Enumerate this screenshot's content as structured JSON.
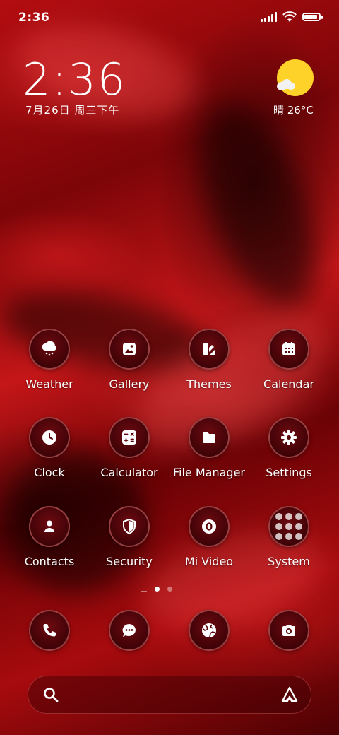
{
  "status_bar": {
    "time": "2:36",
    "battery_level": 1.0
  },
  "clock_widget": {
    "time": "2:36",
    "date": "7月26日 周三下午"
  },
  "weather_widget": {
    "text": "晴 26°C",
    "icon": "sun-cloud-icon"
  },
  "apps": [
    {
      "label": "Weather",
      "icon": "weather-icon"
    },
    {
      "label": "Gallery",
      "icon": "gallery-icon"
    },
    {
      "label": "Themes",
      "icon": "themes-icon"
    },
    {
      "label": "Calendar",
      "icon": "calendar-icon"
    },
    {
      "label": "Clock",
      "icon": "clock-icon"
    },
    {
      "label": "Calculator",
      "icon": "calculator-icon"
    },
    {
      "label": "File Manager",
      "icon": "folder-icon"
    },
    {
      "label": "Settings",
      "icon": "gear-icon"
    },
    {
      "label": "Contacts",
      "icon": "contacts-icon"
    },
    {
      "label": "Security",
      "icon": "shield-icon"
    },
    {
      "label": "Mi Video",
      "icon": "video-icon"
    },
    {
      "label": "System",
      "icon": "folder-grid-icon"
    }
  ],
  "dock": [
    {
      "icon": "phone-icon"
    },
    {
      "icon": "messages-icon"
    },
    {
      "icon": "browser-icon"
    },
    {
      "icon": "camera-icon"
    }
  ],
  "pager": {
    "pages": 2,
    "active": 1
  },
  "colors": {
    "accent_sun": "#ffd22a",
    "wallpaper": "#a70b0e"
  }
}
